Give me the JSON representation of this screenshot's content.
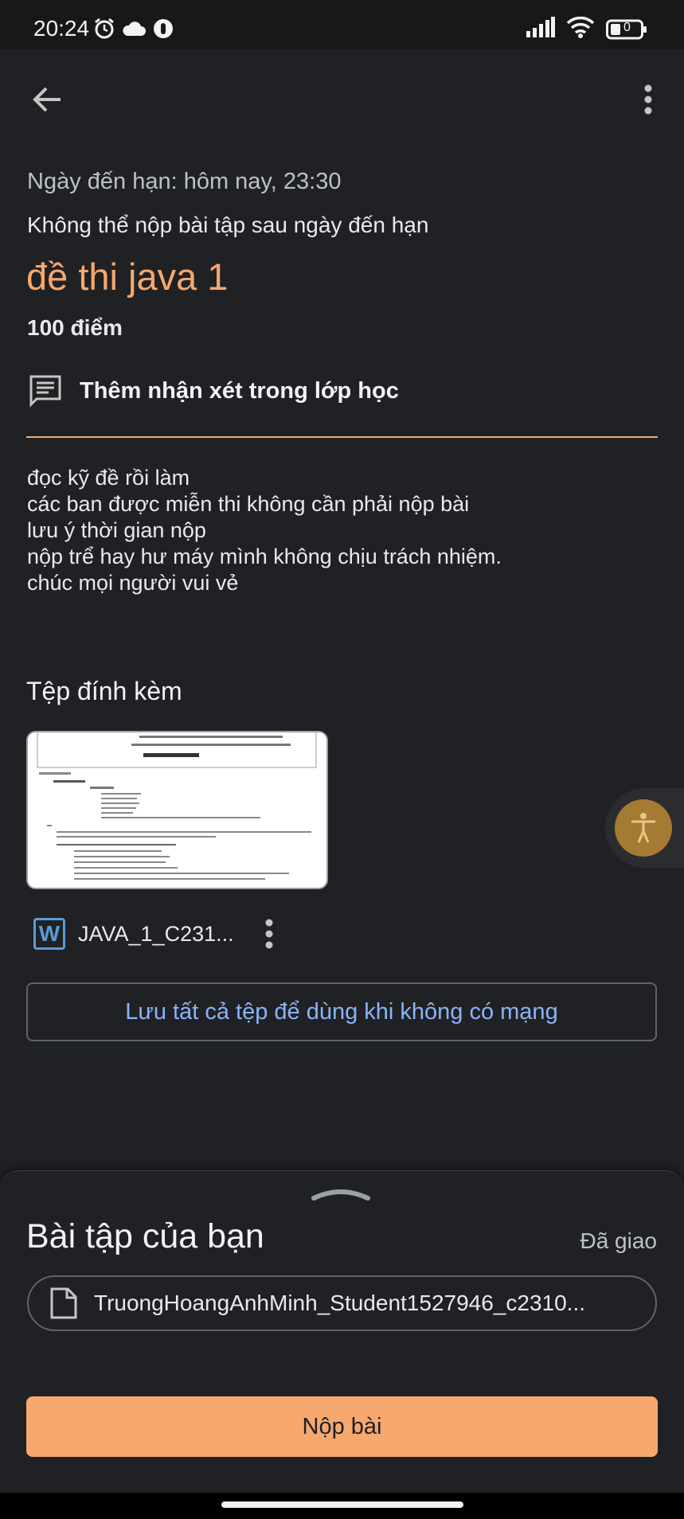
{
  "status_bar": {
    "time": "20:24",
    "left_icons": [
      "alarm-icon",
      "cloud-icon",
      "notification-icon"
    ],
    "right_icons": [
      "signal-icon",
      "wifi-icon",
      "battery-icon"
    ],
    "battery_level": "0"
  },
  "assignment": {
    "due": "Ngày đến hạn: hôm nay, 23:30",
    "late_note": "Không thể nộp bài tập sau ngày đến hạn",
    "title": "đề thi java 1",
    "points": "100 điểm",
    "comment_label": "Thêm nhận xét trong lớp học",
    "instructions": [
      "đọc kỹ đề rồi làm",
      "các ban được miễn thi không cần phải nộp bài",
      "lưu ý thời gian nộp",
      "nộp trể hay hư máy mình không chịu trách nhiệm.",
      "chúc mọi người vui vẻ"
    ]
  },
  "attachments": {
    "heading": "Tệp đính kèm",
    "file_name": "JAVA_1_C231...",
    "file_icon": "word-icon",
    "offline_button": "Lưu tất cả tệp để dùng khi không có mạng"
  },
  "your_work": {
    "title": "Bài tập của bạn",
    "status": "Đã giao",
    "file_name": "TruongHoangAnhMinh_Student1527946_c2310...",
    "submit_label": "Nộp bài"
  },
  "colors": {
    "accent": "#f6a86e",
    "link": "#8ab4f8",
    "background": "#202124"
  }
}
